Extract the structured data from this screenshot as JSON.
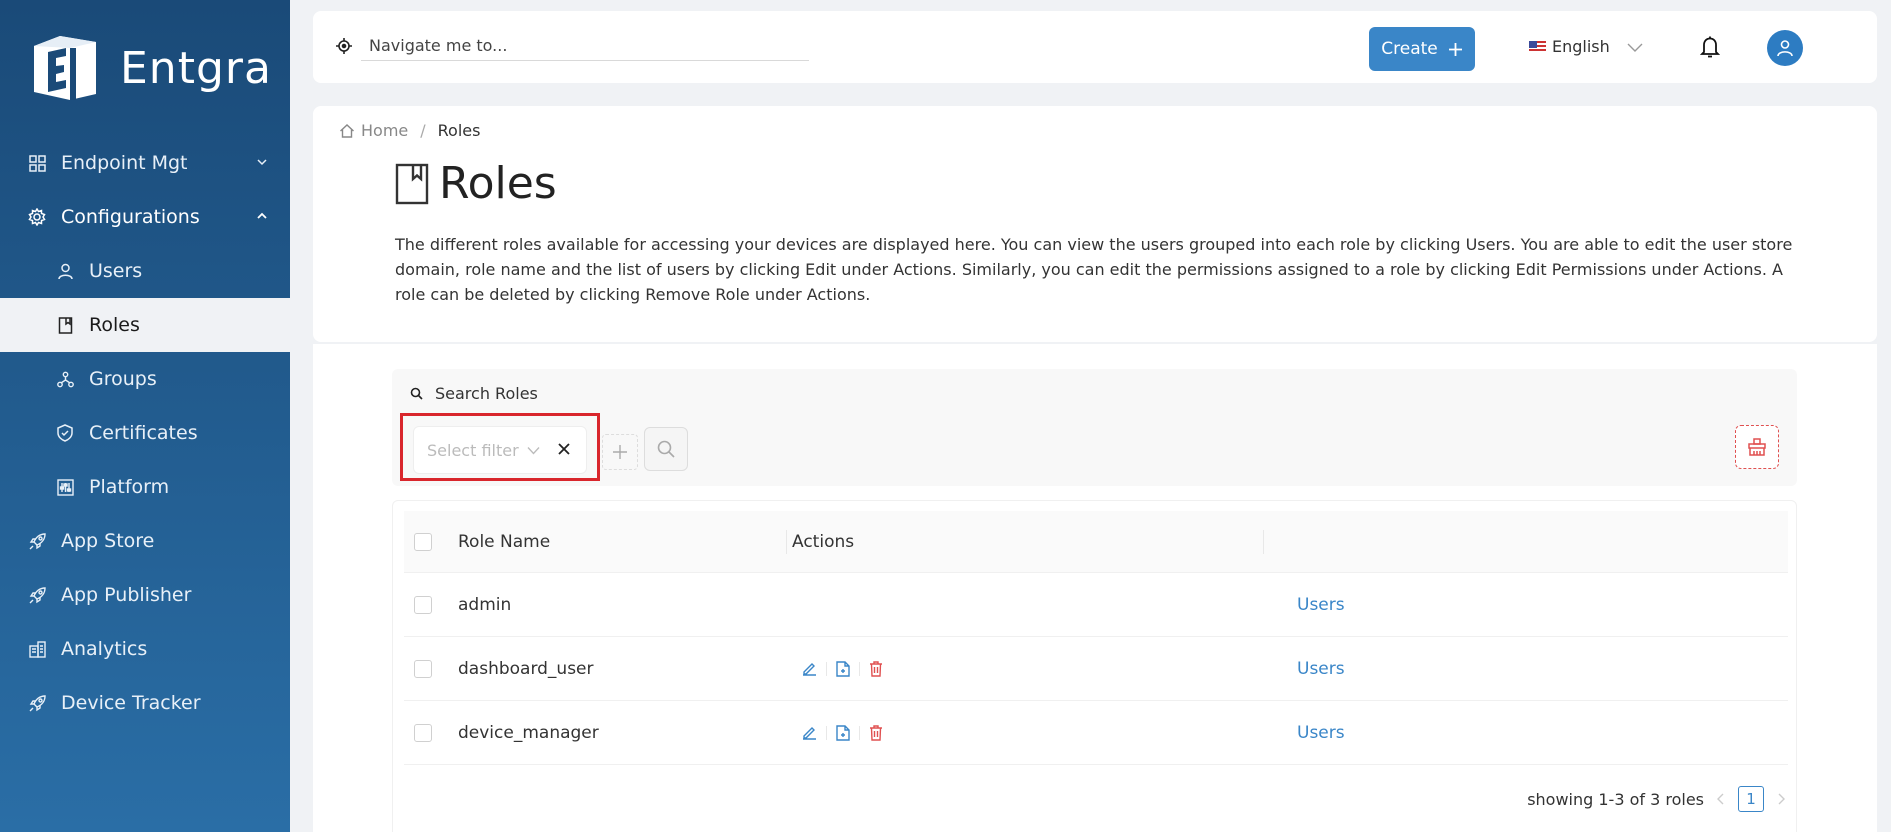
{
  "brand": {
    "name": "Entgra"
  },
  "sidebar": {
    "items": [
      {
        "label": "Endpoint Mgt",
        "icon": "grid-icon",
        "chevron": "down"
      },
      {
        "label": "Configurations",
        "icon": "gear-icon",
        "chevron": "up"
      },
      {
        "label": "Users",
        "icon": "user-icon"
      },
      {
        "label": "Roles",
        "icon": "book-icon"
      },
      {
        "label": "Groups",
        "icon": "groups-icon"
      },
      {
        "label": "Certificates",
        "icon": "shield-icon"
      },
      {
        "label": "Platform",
        "icon": "sliders-icon"
      },
      {
        "label": "App Store",
        "icon": "rocket-icon"
      },
      {
        "label": "App Publisher",
        "icon": "rocket-icon"
      },
      {
        "label": "Analytics",
        "icon": "building-icon"
      },
      {
        "label": "Device Tracker",
        "icon": "rocket-icon"
      }
    ]
  },
  "topbar": {
    "nav_placeholder": "Navigate me to...",
    "create_label": "Create",
    "language": "English"
  },
  "breadcrumb": {
    "home": "Home",
    "current": "Roles"
  },
  "page": {
    "title": "Roles",
    "description": "The different roles available for accessing your devices are displayed here. You can view the users grouped into each role by clicking Users. You are able to edit the user store domain, role name and the list of users by clicking Edit under Actions. Similarly, you can edit the permissions assigned to a role by clicking Edit Permissions under Actions. A role can be deleted by clicking Remove Role under Actions."
  },
  "search": {
    "label": "Search Roles",
    "filter_placeholder": "Select filter"
  },
  "table": {
    "headers": {
      "name": "Role Name",
      "actions": "Actions"
    },
    "rows": [
      {
        "name": "admin",
        "has_actions": false,
        "users": "Users"
      },
      {
        "name": "dashboard_user",
        "has_actions": true,
        "users": "Users"
      },
      {
        "name": "device_manager",
        "has_actions": true,
        "users": "Users"
      }
    ]
  },
  "pagination": {
    "summary": "showing 1-3 of 3 roles",
    "page": "1"
  },
  "colors": {
    "accent": "#3a86c8",
    "danger": "#e05050",
    "highlight": "#d9262c",
    "sidebar_top": "#1a4a78",
    "sidebar_bottom": "#2a6ea6"
  }
}
